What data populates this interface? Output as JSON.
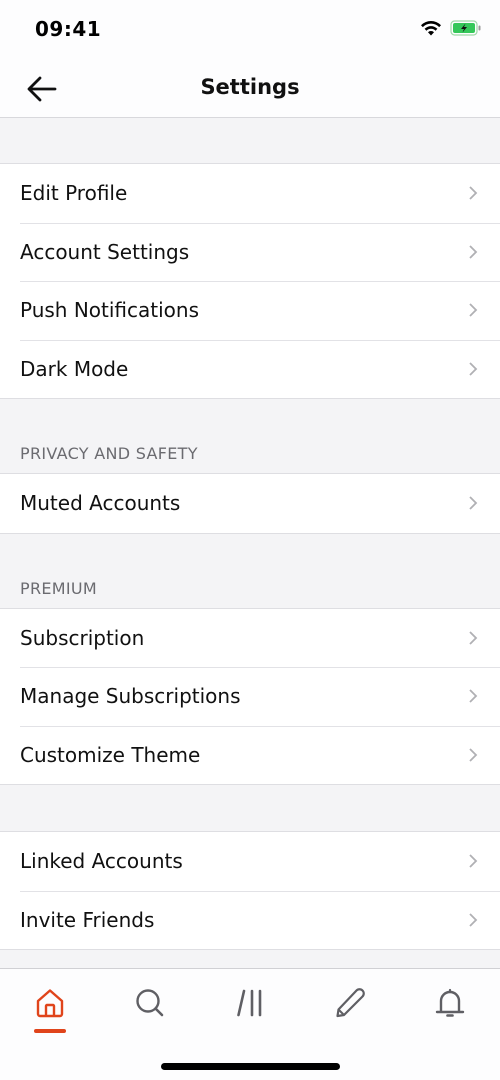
{
  "status_bar": {
    "time": "09:41",
    "icons": [
      "wifi-icon",
      "battery-charging-icon"
    ],
    "battery_color": "#34c759"
  },
  "nav": {
    "title": "Settings",
    "back_icon": "arrow-left-icon"
  },
  "sections": [
    {
      "header": "",
      "items": [
        {
          "label": "Edit Profile"
        },
        {
          "label": "Account Settings"
        },
        {
          "label": "Push Notifications"
        },
        {
          "label": "Dark Mode"
        }
      ]
    },
    {
      "header": "PRIVACY AND SAFETY",
      "items": [
        {
          "label": "Muted Accounts"
        }
      ]
    },
    {
      "header": "PREMIUM",
      "items": [
        {
          "label": "Subscription"
        },
        {
          "label": "Manage Subscriptions"
        },
        {
          "label": "Customize Theme"
        }
      ]
    },
    {
      "header": "",
      "items": [
        {
          "label": "Linked Accounts"
        },
        {
          "label": "Invite Friends"
        }
      ]
    }
  ],
  "tab_bar": {
    "active_color": "#e0441b",
    "inactive_color": "#5f5f64",
    "tabs": [
      {
        "icon": "home-icon",
        "active": true
      },
      {
        "icon": "search-icon",
        "active": false
      },
      {
        "icon": "library-icon",
        "active": false
      },
      {
        "icon": "pencil-icon",
        "active": false
      },
      {
        "icon": "bell-icon",
        "active": false
      }
    ]
  }
}
